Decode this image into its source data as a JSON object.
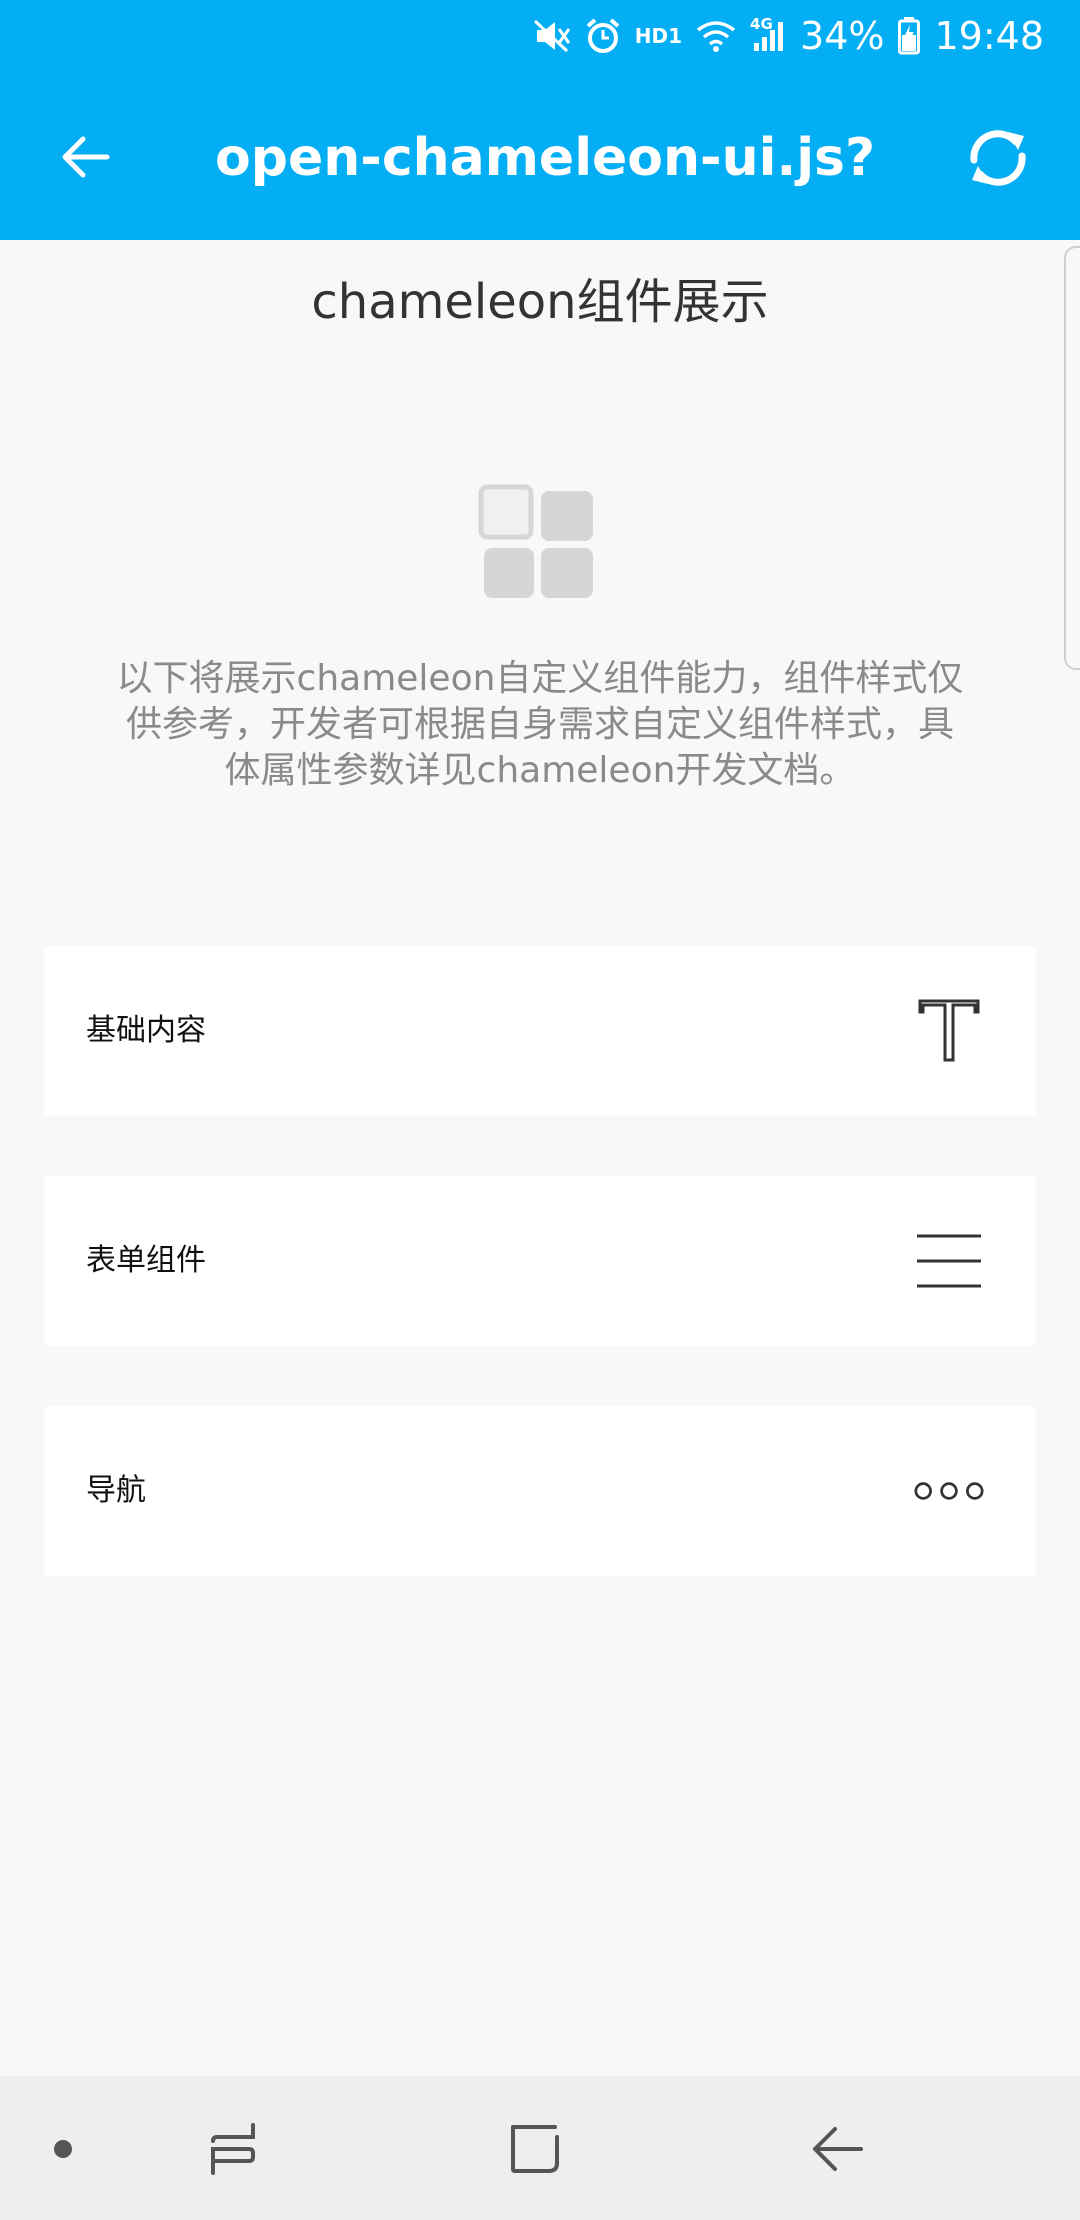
{
  "status_bar": {
    "battery_percent": "34%",
    "time": "19:48",
    "hd_label": "HD1",
    "network_label": "4G",
    "icons": [
      "mute-icon",
      "alarm-icon",
      "wifi-icon",
      "signal-icon",
      "battery-icon"
    ]
  },
  "app_bar": {
    "title": "open-chameleon-ui.js?…",
    "back_icon": "arrow-left-icon",
    "refresh_icon": "refresh-icon"
  },
  "main": {
    "heading": "chameleon组件展示",
    "hero_icon": "grid-icon",
    "description": "以下将展示chameleon自定义组件能力，组件样式仅供参考，开发者可根据自身需求自定义组件样式，具体属性参数详见chameleon开发文档。",
    "menu_items": [
      {
        "label": "基础内容",
        "icon": "text-icon"
      },
      {
        "label": "表单组件",
        "icon": "lines-icon"
      },
      {
        "label": "导航",
        "icon": "dots-icon"
      }
    ]
  },
  "nav_bar": {
    "icons": [
      "dot-icon",
      "recents-icon",
      "home-icon",
      "back-icon"
    ]
  },
  "colors": {
    "accent": "#03aef5",
    "background": "#f8f8f8",
    "card": "#ffffff",
    "description_text": "#8a8a8a"
  }
}
